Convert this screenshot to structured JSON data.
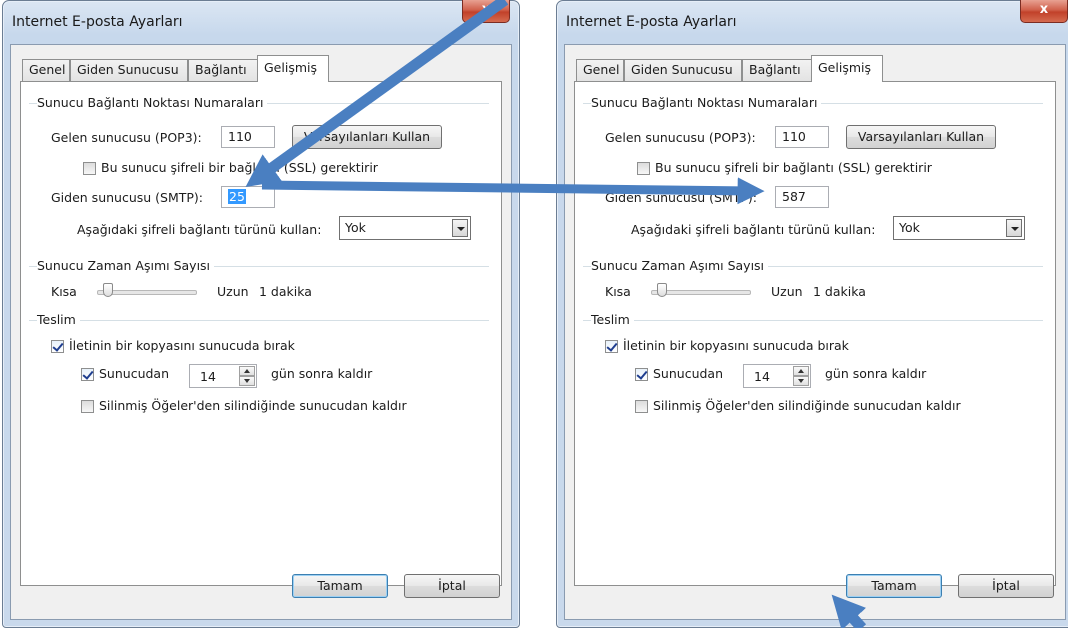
{
  "dialog_left": {
    "title": "Internet E-posta Ayarları",
    "close_label": "x",
    "tabs": [
      "Genel",
      "Giden Sunucusu",
      "Bağlantı",
      "Gelişmiş"
    ],
    "server_ports_group": "Sunucu Bağlantı Noktası Numaraları",
    "incoming_label": "Gelen sunucusu (POP3):",
    "incoming_value": "110",
    "defaults_button": "Varsayılanları Kullan",
    "ssl_checkbox": "Bu sunucu şifreli bir bağlantı (SSL) gerektirir",
    "outgoing_label": "Giden sunucusu (SMTP):",
    "outgoing_value": "25",
    "encryption_label": "Aşağıdaki şifreli bağlantı türünü kullan:",
    "encryption_value": "Yok",
    "timeout_group": "Sunucu Zaman Aşımı Sayısı",
    "timeout_short": "Kısa",
    "timeout_long": "Uzun",
    "timeout_value": "1 dakika",
    "delivery_group": "Teslim",
    "keep_copy": "İletinin bir kopyasını sunucuda bırak",
    "remove_after": "Sunucudan",
    "remove_days": "14",
    "remove_suffix": "gün sonra kaldır",
    "remove_deleted": "Silinmiş Öğeler'den silindiğinde sunucudan kaldır",
    "ok_button": "Tamam",
    "cancel_button": "İptal"
  },
  "dialog_right": {
    "title": "Internet E-posta Ayarları",
    "close_label": "x",
    "tabs": [
      "Genel",
      "Giden Sunucusu",
      "Bağlantı",
      "Gelişmiş"
    ],
    "server_ports_group": "Sunucu Bağlantı Noktası Numaraları",
    "incoming_label": "Gelen sunucusu (POP3):",
    "incoming_value": "110",
    "defaults_button": "Varsayılanları Kullan",
    "ssl_checkbox": "Bu sunucu şifreli bir bağlantı (SSL) gerektirir",
    "outgoing_label": "Giden sunucusu (SMTP):",
    "outgoing_value": "587",
    "encryption_label": "Aşağıdaki şifreli bağlantı türünü kullan:",
    "encryption_value": "Yok",
    "timeout_group": "Sunucu Zaman Aşımı Sayısı",
    "timeout_short": "Kısa",
    "timeout_long": "Uzun",
    "timeout_value": "1 dakika",
    "delivery_group": "Teslim",
    "keep_copy": "İletinin bir kopyasını sunucuda bırak",
    "remove_after": "Sunucudan",
    "remove_days": "14",
    "remove_suffix": "gün sonra kaldır",
    "remove_deleted": "Silinmiş Öğeler'den silindiğinde sunucudan kaldır",
    "ok_button": "Tamam",
    "cancel_button": "İptal"
  },
  "colors": {
    "annotation_arrow": "#4a7fc1"
  }
}
